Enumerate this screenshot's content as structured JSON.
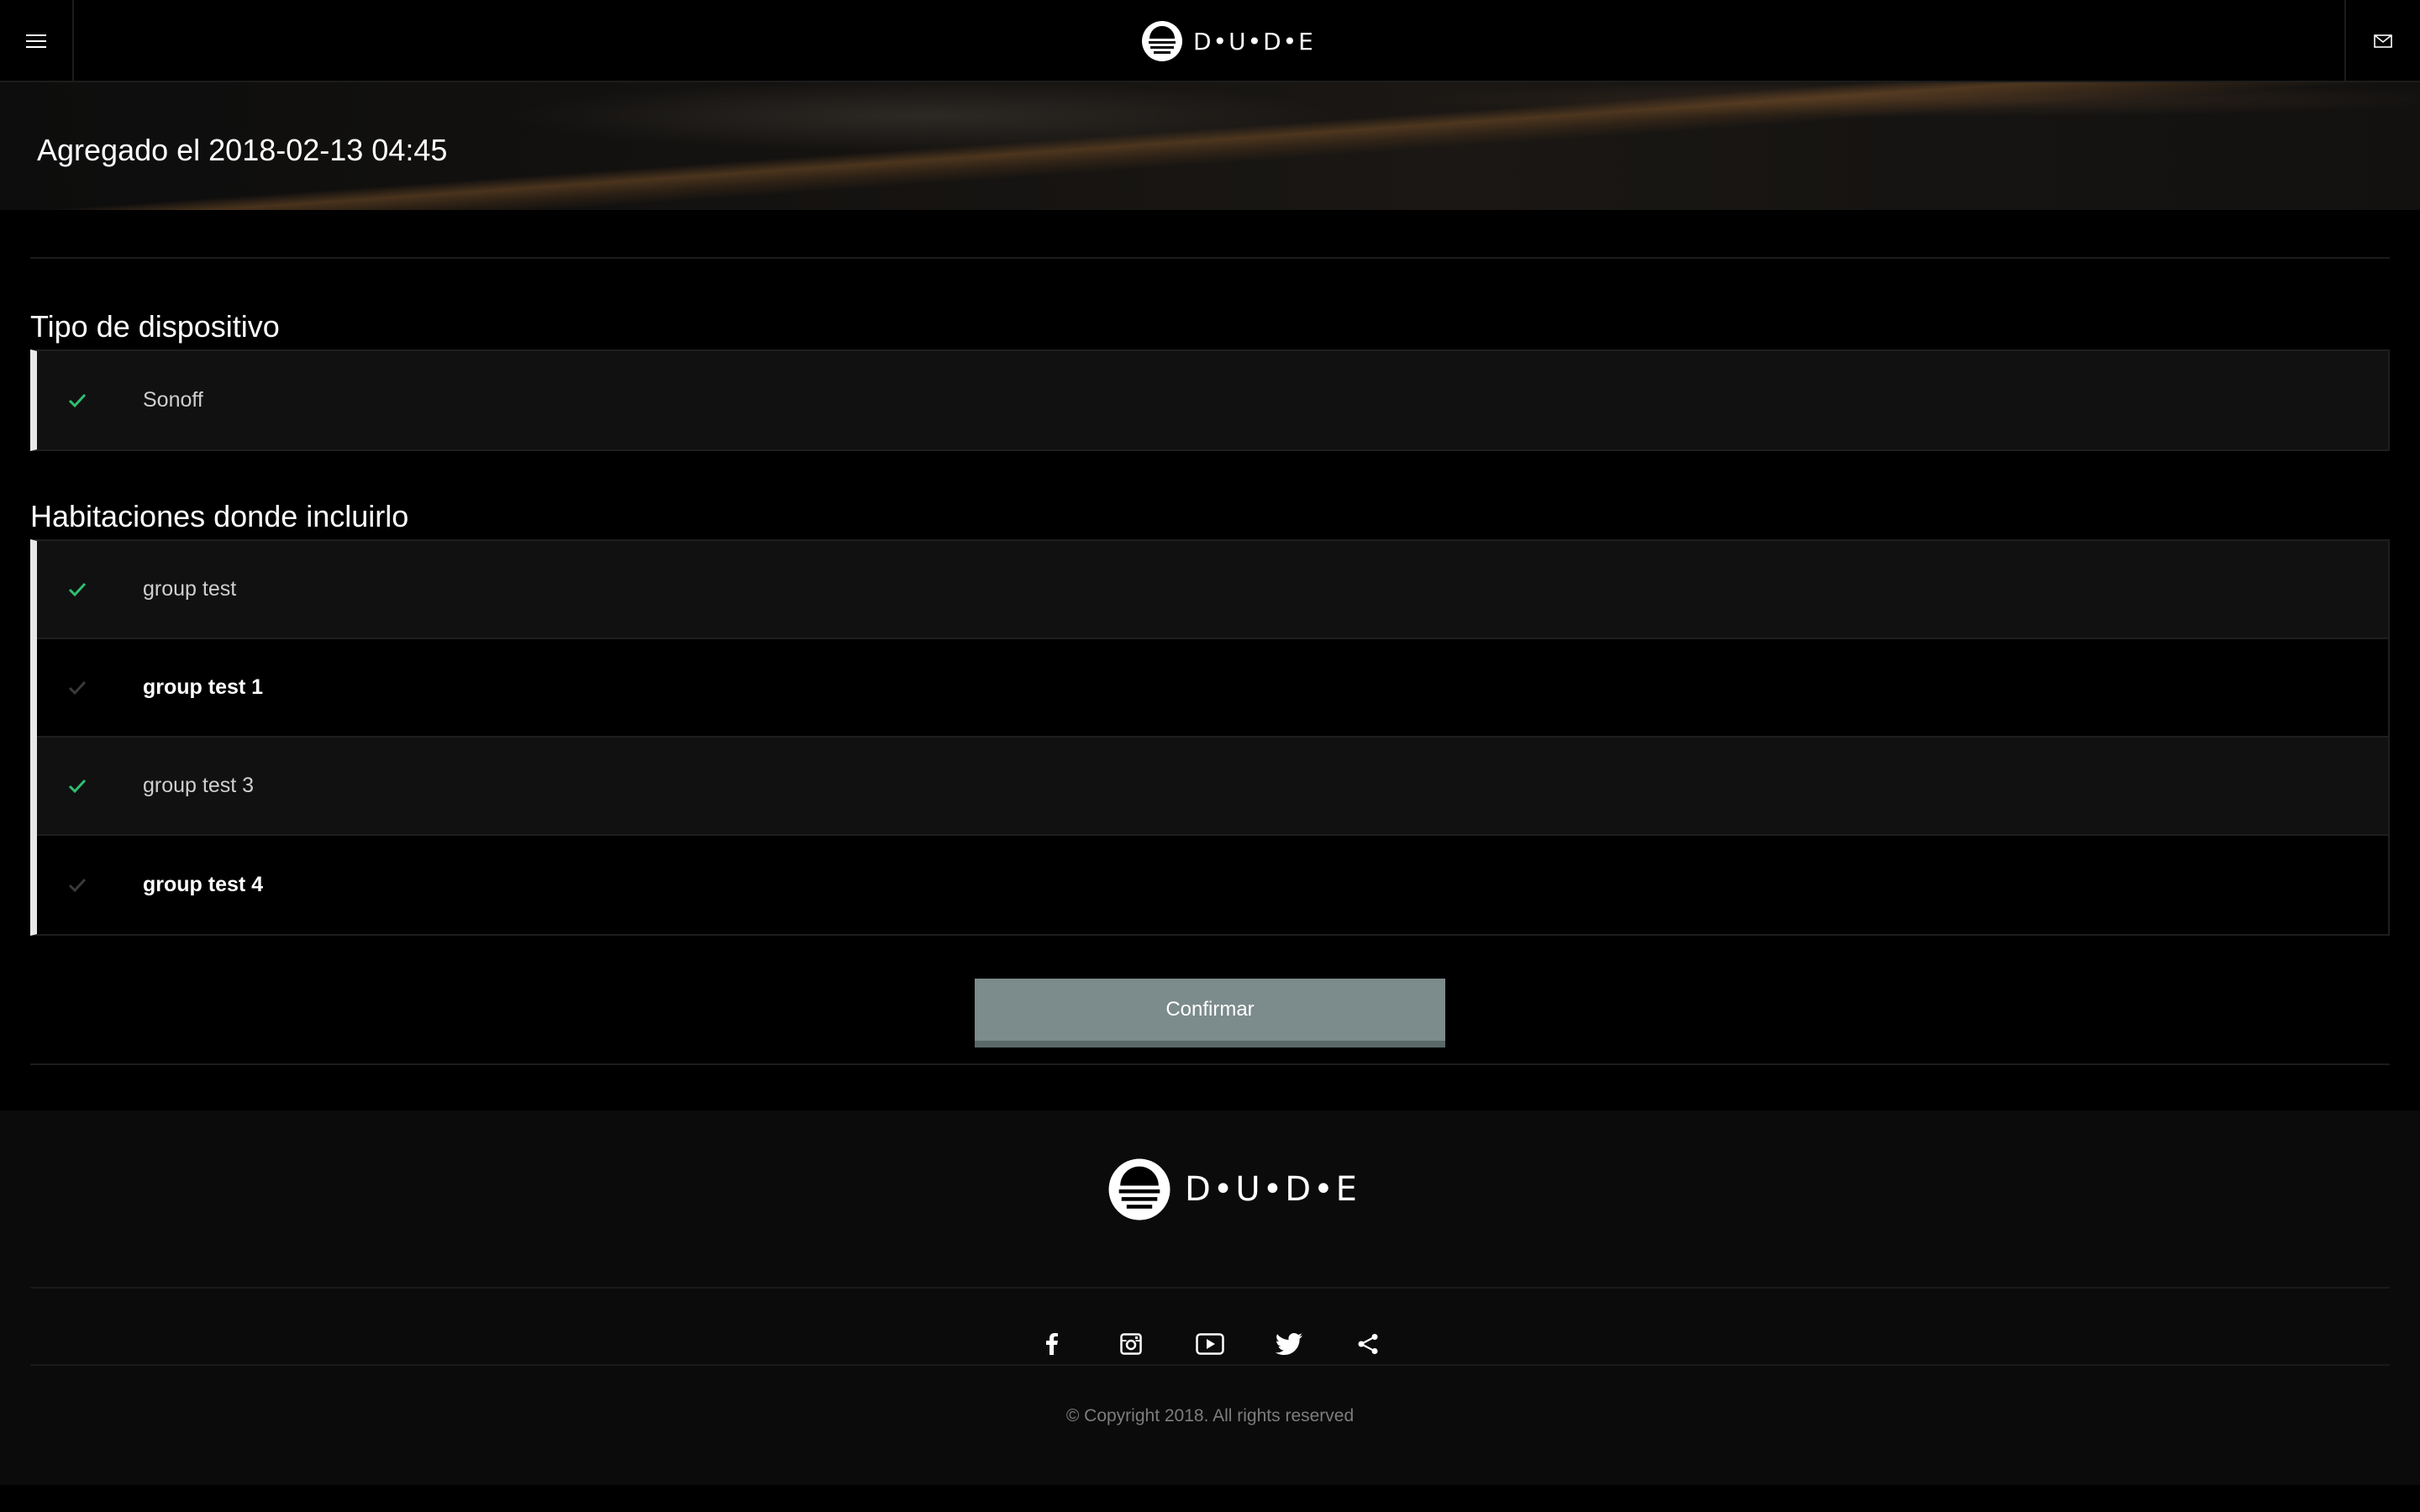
{
  "header": {
    "brand": "D•U•D•E",
    "menu_icon": "hamburger-menu-icon",
    "mail_icon": "mail-icon"
  },
  "hero": {
    "title": "Agregado el 2018-02-13 04:45"
  },
  "device_type": {
    "title": "Tipo de dispositivo",
    "items": [
      {
        "label": "Sonoff",
        "selected": true
      }
    ]
  },
  "rooms": {
    "title": "Habitaciones donde incluirlo",
    "items": [
      {
        "label": "group test",
        "selected": true
      },
      {
        "label": "group test 1",
        "selected": false
      },
      {
        "label": "group test 3",
        "selected": true
      },
      {
        "label": "group test 4",
        "selected": false
      }
    ]
  },
  "actions": {
    "confirm_label": "Confirmar"
  },
  "footer": {
    "brand": "D•U•D•E",
    "social": [
      "facebook-icon",
      "instagram-icon",
      "youtube-icon",
      "twitter-icon",
      "share-icon"
    ],
    "copyright": "© Copyright 2018. All rights reserved"
  },
  "colors": {
    "check_active": "#2fbf71",
    "check_inactive": "#3a3a3a",
    "confirm_button": "#7c8b8b"
  }
}
